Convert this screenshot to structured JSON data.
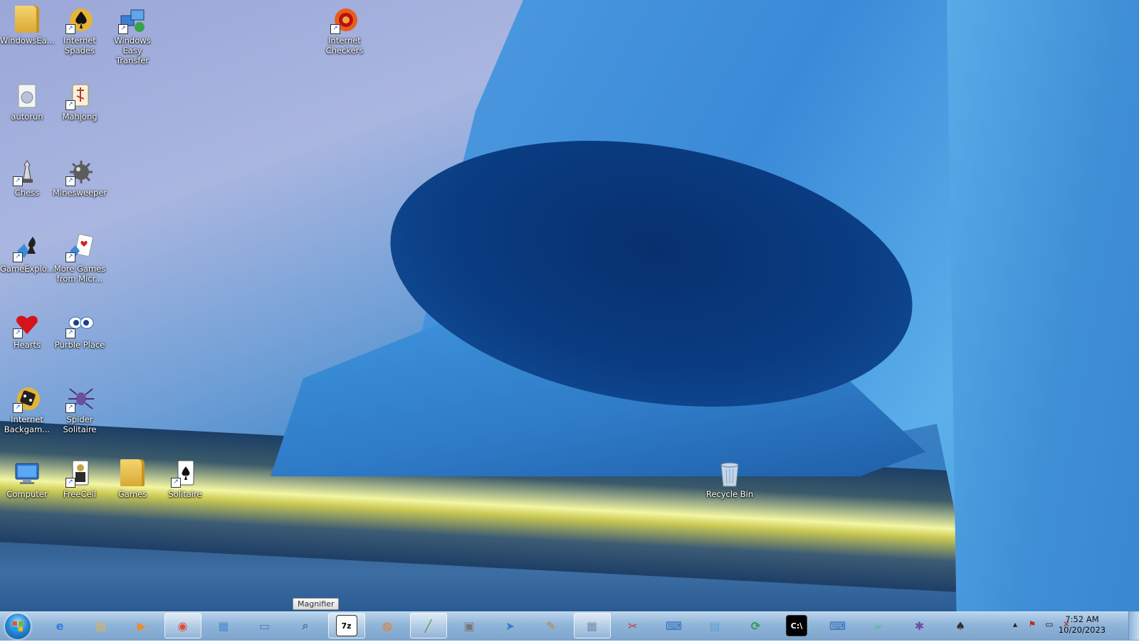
{
  "desktop": {
    "icons": [
      {
        "label": "WindowsEa...",
        "icon": "folder-icon"
      },
      {
        "label": "Internet Spades",
        "icon": "spades-icon"
      },
      {
        "label": "Windows Easy Transfer",
        "icon": "easy-transfer-icon"
      },
      {
        "label": "Internet Checkers",
        "icon": "checkers-icon"
      },
      {
        "label": "autorun",
        "icon": "autorun-icon"
      },
      {
        "label": "Mahjong",
        "icon": "mahjong-icon"
      },
      {
        "label": "Chess",
        "icon": "chess-icon"
      },
      {
        "label": "Minesweeper",
        "icon": "minesweeper-icon"
      },
      {
        "label": "GameExplo...",
        "icon": "game-explorer-icon"
      },
      {
        "label": "More Games from Micr...",
        "icon": "more-games-icon"
      },
      {
        "label": "Hearts",
        "icon": "hearts-icon"
      },
      {
        "label": "Purble Place",
        "icon": "purble-place-icon"
      },
      {
        "label": "Internet Backgam...",
        "icon": "backgammon-icon"
      },
      {
        "label": "Spider Solitaire",
        "icon": "spider-solitaire-icon"
      },
      {
        "label": "Computer",
        "icon": "computer-icon"
      },
      {
        "label": "FreeCell",
        "icon": "freecell-icon"
      },
      {
        "label": "Games",
        "icon": "folder-icon"
      },
      {
        "label": "Solitaire",
        "icon": "solitaire-icon"
      },
      {
        "label": "Recycle Bin",
        "icon": "recycle-bin-icon"
      }
    ]
  },
  "taskbar": {
    "tooltip": "Magnifier",
    "clock": {
      "time": "7:52 AM",
      "date": "10/20/2023"
    },
    "apps": [
      {
        "name": "internet-explorer",
        "glyph": "e",
        "color": "#2f7de0"
      },
      {
        "name": "file-explorer",
        "glyph": "▤",
        "color": "#e2b54a"
      },
      {
        "name": "media-player",
        "glyph": "▶",
        "color": "#f08a2a"
      },
      {
        "name": "chrome",
        "glyph": "◉",
        "color": "#de4b39"
      },
      {
        "name": "control-panel",
        "glyph": "▦",
        "color": "#4b8ad0"
      },
      {
        "name": "remote-desktop",
        "glyph": "▭",
        "color": "#3f7fc4"
      },
      {
        "name": "magnifier",
        "glyph": "⌕",
        "color": "#3a6fb3"
      },
      {
        "name": "7zip",
        "glyph": "7z",
        "color": "#111111"
      },
      {
        "name": "firefox",
        "glyph": "◍",
        "color": "#f27a22"
      },
      {
        "name": "task-manager",
        "glyph": "╱",
        "color": "#3ea24a"
      },
      {
        "name": "fax-scan",
        "glyph": "▣",
        "color": "#777777"
      },
      {
        "name": "paper-plane",
        "glyph": "➤",
        "color": "#3a7ed0"
      },
      {
        "name": "paint",
        "glyph": "✎",
        "color": "#c57d3a"
      },
      {
        "name": "calculator",
        "glyph": "▦",
        "color": "#6d8fb5"
      },
      {
        "name": "snipping-tool",
        "glyph": "✂",
        "color": "#c23b3b"
      },
      {
        "name": "network",
        "glyph": "⌨",
        "color": "#2f6db8"
      },
      {
        "name": "notepad",
        "glyph": "▤",
        "color": "#5aa0d0"
      },
      {
        "name": "sync-center",
        "glyph": "⟳",
        "color": "#2c9a4a"
      },
      {
        "name": "command-prompt",
        "glyph": "C:\\",
        "color": "#000000"
      },
      {
        "name": "on-screen-keyboard",
        "glyph": "⌨",
        "color": "#2f6db8"
      },
      {
        "name": "sticky-notes",
        "glyph": "▰",
        "color": "#6fb8b0"
      },
      {
        "name": "spider-solitaire",
        "glyph": "✱",
        "color": "#6b4fa0"
      },
      {
        "name": "solitaire",
        "glyph": "♠",
        "color": "#333333"
      }
    ]
  }
}
